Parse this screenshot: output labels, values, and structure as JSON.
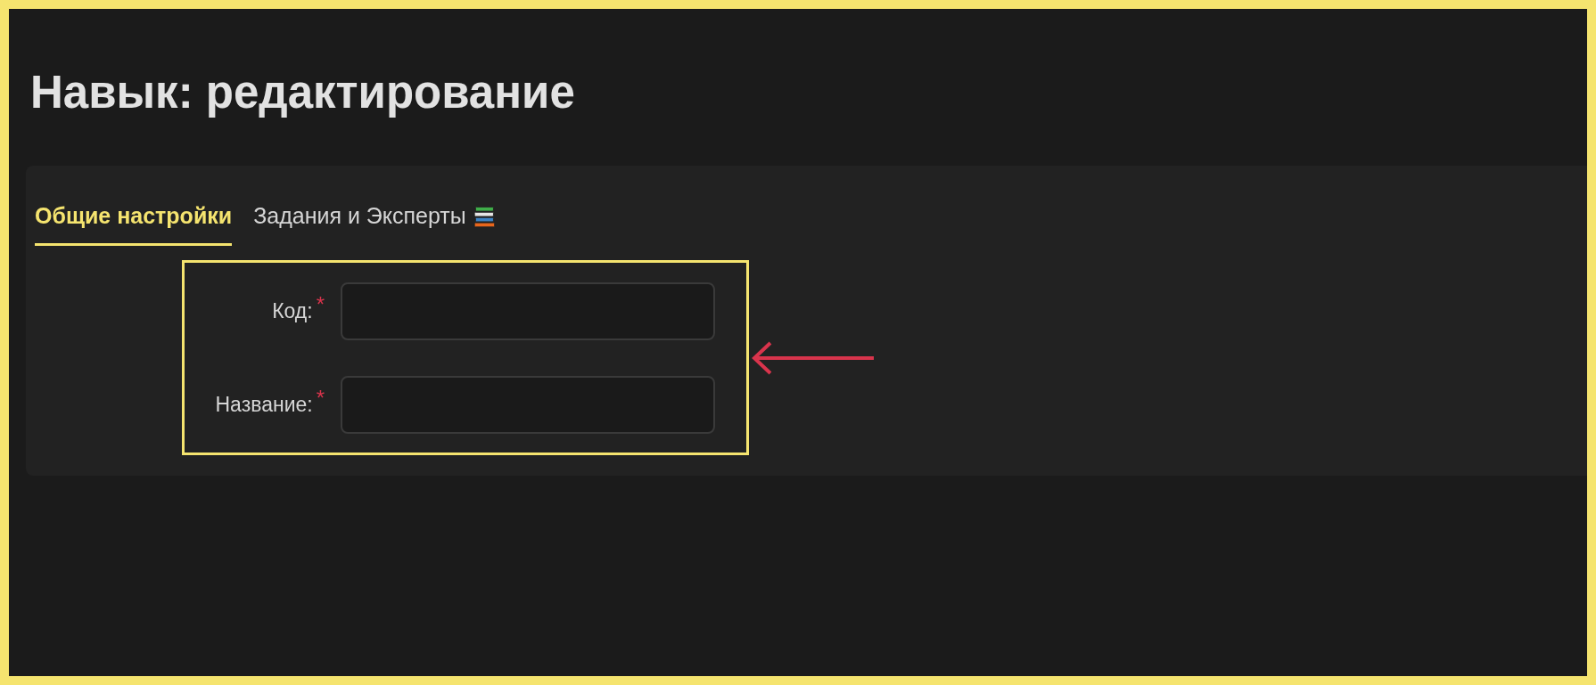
{
  "page_title": "Навык: редактирование",
  "tabs": [
    {
      "label": "Общие настройки",
      "selected": true,
      "has_icon": false
    },
    {
      "label": "Задания и Эксперты",
      "selected": false,
      "has_icon": true
    }
  ],
  "form": {
    "fields": [
      {
        "label": "Код:",
        "required": true
      },
      {
        "label": "Название:",
        "required": true
      }
    ]
  },
  "asterisk": "*"
}
